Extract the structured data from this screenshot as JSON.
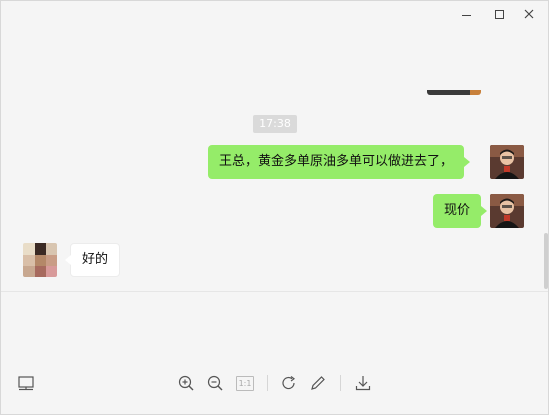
{
  "window": {
    "controls": {
      "minimize_icon": "minimize-icon",
      "maximize_icon": "maximize-icon",
      "close_icon": "close-icon"
    }
  },
  "chat": {
    "timestamp": "17:38",
    "messages": [
      {
        "direction": "outgoing",
        "text": "王总，黄金多单原油多单可以做进去了，"
      },
      {
        "direction": "outgoing",
        "text": "现价"
      },
      {
        "direction": "incoming",
        "text": "好的"
      }
    ]
  },
  "toolbar": {
    "icons": [
      "screenshot-icon",
      "zoom-in-icon",
      "zoom-out-icon",
      "actual-size-icon",
      "rotate-icon",
      "edit-icon",
      "download-icon"
    ],
    "actual_size_label": "1:1"
  },
  "colors": {
    "outgoing_bubble": "#95ec69",
    "incoming_bubble": "#ffffff",
    "background": "#f5f5f5",
    "timestamp_bg": "#dadada"
  }
}
